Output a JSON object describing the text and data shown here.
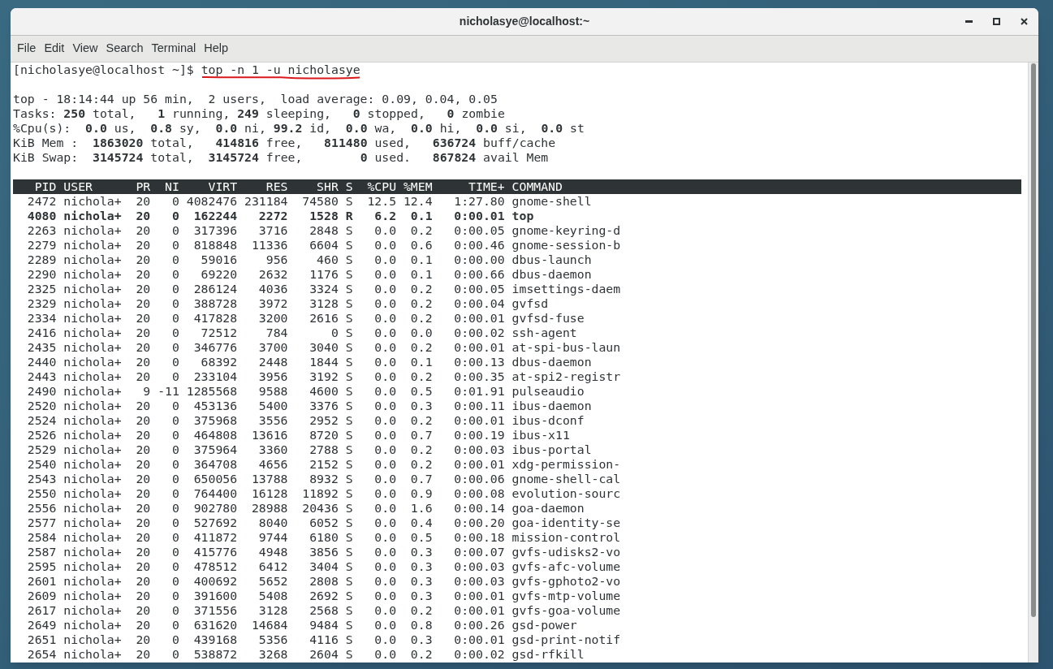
{
  "window": {
    "title": "nicholasye@localhost:~"
  },
  "menu": [
    "File",
    "Edit",
    "View",
    "Search",
    "Terminal",
    "Help"
  ],
  "prompt": {
    "text": "[nicholasye@localhost ~]$ ",
    "command": "top -n 1 -u nicholasye",
    "underlined": true
  },
  "summary": [
    "top - 18:14:44 up 56 min,  2 users,  load average: 0.09, 0.04, 0.05",
    "Tasks: **250** total,   **1** running, **249** sleeping,   **0** stopped,   **0** zombie",
    "%Cpu(s):  **0.0** us,  **0.8** sy,  **0.0** ni, **99.2** id,  **0.0** wa,  **0.0** hi,  **0.0** si,  **0.0** st",
    "KiB Mem :  **1863020** total,   **414816** free,   **811480** used,   **636724** buff/cache",
    "KiB Swap:  **3145724** total,  **3145724** free,        **0** used.   **867824** avail Mem"
  ],
  "table": {
    "columns": [
      "PID",
      "USER",
      "PR",
      "NI",
      "VIRT",
      "RES",
      "SHR",
      "S",
      "%CPU",
      "%MEM",
      "TIME+",
      "COMMAND"
    ],
    "rows": [
      {
        "highlighted": false,
        "cells": [
          "2472",
          "nichola+",
          "20",
          "0",
          "4082476",
          "231184",
          "74580",
          "S",
          "12.5",
          "12.4",
          "1:27.80",
          "gnome-shell"
        ]
      },
      {
        "highlighted": true,
        "cells": [
          "4080",
          "nichola+",
          "20",
          "0",
          "162244",
          "2272",
          "1528",
          "R",
          "6.2",
          "0.1",
          "0:00.01",
          "top"
        ]
      },
      {
        "highlighted": false,
        "cells": [
          "2263",
          "nichola+",
          "20",
          "0",
          "317396",
          "3716",
          "2848",
          "S",
          "0.0",
          "0.2",
          "0:00.05",
          "gnome-keyring-d"
        ]
      },
      {
        "highlighted": false,
        "cells": [
          "2279",
          "nichola+",
          "20",
          "0",
          "818848",
          "11336",
          "6604",
          "S",
          "0.0",
          "0.6",
          "0:00.46",
          "gnome-session-b"
        ]
      },
      {
        "highlighted": false,
        "cells": [
          "2289",
          "nichola+",
          "20",
          "0",
          "59016",
          "956",
          "460",
          "S",
          "0.0",
          "0.1",
          "0:00.00",
          "dbus-launch"
        ]
      },
      {
        "highlighted": false,
        "cells": [
          "2290",
          "nichola+",
          "20",
          "0",
          "69220",
          "2632",
          "1176",
          "S",
          "0.0",
          "0.1",
          "0:00.66",
          "dbus-daemon"
        ]
      },
      {
        "highlighted": false,
        "cells": [
          "2325",
          "nichola+",
          "20",
          "0",
          "286124",
          "4036",
          "3324",
          "S",
          "0.0",
          "0.2",
          "0:00.05",
          "imsettings-daem"
        ]
      },
      {
        "highlighted": false,
        "cells": [
          "2329",
          "nichola+",
          "20",
          "0",
          "388728",
          "3972",
          "3128",
          "S",
          "0.0",
          "0.2",
          "0:00.04",
          "gvfsd"
        ]
      },
      {
        "highlighted": false,
        "cells": [
          "2334",
          "nichola+",
          "20",
          "0",
          "417828",
          "3200",
          "2616",
          "S",
          "0.0",
          "0.2",
          "0:00.01",
          "gvfsd-fuse"
        ]
      },
      {
        "highlighted": false,
        "cells": [
          "2416",
          "nichola+",
          "20",
          "0",
          "72512",
          "784",
          "0",
          "S",
          "0.0",
          "0.0",
          "0:00.02",
          "ssh-agent"
        ]
      },
      {
        "highlighted": false,
        "cells": [
          "2435",
          "nichola+",
          "20",
          "0",
          "346776",
          "3700",
          "3040",
          "S",
          "0.0",
          "0.2",
          "0:00.01",
          "at-spi-bus-laun"
        ]
      },
      {
        "highlighted": false,
        "cells": [
          "2440",
          "nichola+",
          "20",
          "0",
          "68392",
          "2448",
          "1844",
          "S",
          "0.0",
          "0.1",
          "0:00.13",
          "dbus-daemon"
        ]
      },
      {
        "highlighted": false,
        "cells": [
          "2443",
          "nichola+",
          "20",
          "0",
          "233104",
          "3956",
          "3192",
          "S",
          "0.0",
          "0.2",
          "0:00.35",
          "at-spi2-registr"
        ]
      },
      {
        "highlighted": false,
        "cells": [
          "2490",
          "nichola+",
          "9",
          "-11",
          "1285568",
          "9588",
          "4600",
          "S",
          "0.0",
          "0.5",
          "0:01.91",
          "pulseaudio"
        ]
      },
      {
        "highlighted": false,
        "cells": [
          "2520",
          "nichola+",
          "20",
          "0",
          "453136",
          "5400",
          "3376",
          "S",
          "0.0",
          "0.3",
          "0:00.11",
          "ibus-daemon"
        ]
      },
      {
        "highlighted": false,
        "cells": [
          "2524",
          "nichola+",
          "20",
          "0",
          "375968",
          "3556",
          "2952",
          "S",
          "0.0",
          "0.2",
          "0:00.01",
          "ibus-dconf"
        ]
      },
      {
        "highlighted": false,
        "cells": [
          "2526",
          "nichola+",
          "20",
          "0",
          "464808",
          "13616",
          "8720",
          "S",
          "0.0",
          "0.7",
          "0:00.19",
          "ibus-x11"
        ]
      },
      {
        "highlighted": false,
        "cells": [
          "2529",
          "nichola+",
          "20",
          "0",
          "375964",
          "3360",
          "2788",
          "S",
          "0.0",
          "0.2",
          "0:00.03",
          "ibus-portal"
        ]
      },
      {
        "highlighted": false,
        "cells": [
          "2540",
          "nichola+",
          "20",
          "0",
          "364708",
          "4656",
          "2152",
          "S",
          "0.0",
          "0.2",
          "0:00.01",
          "xdg-permission-"
        ]
      },
      {
        "highlighted": false,
        "cells": [
          "2543",
          "nichola+",
          "20",
          "0",
          "650056",
          "13788",
          "8932",
          "S",
          "0.0",
          "0.7",
          "0:00.06",
          "gnome-shell-cal"
        ]
      },
      {
        "highlighted": false,
        "cells": [
          "2550",
          "nichola+",
          "20",
          "0",
          "764400",
          "16128",
          "11892",
          "S",
          "0.0",
          "0.9",
          "0:00.08",
          "evolution-sourc"
        ]
      },
      {
        "highlighted": false,
        "cells": [
          "2556",
          "nichola+",
          "20",
          "0",
          "902780",
          "28988",
          "20436",
          "S",
          "0.0",
          "1.6",
          "0:00.14",
          "goa-daemon"
        ]
      },
      {
        "highlighted": false,
        "cells": [
          "2577",
          "nichola+",
          "20",
          "0",
          "527692",
          "8040",
          "6052",
          "S",
          "0.0",
          "0.4",
          "0:00.20",
          "goa-identity-se"
        ]
      },
      {
        "highlighted": false,
        "cells": [
          "2584",
          "nichola+",
          "20",
          "0",
          "411872",
          "9744",
          "6180",
          "S",
          "0.0",
          "0.5",
          "0:00.18",
          "mission-control"
        ]
      },
      {
        "highlighted": false,
        "cells": [
          "2587",
          "nichola+",
          "20",
          "0",
          "415776",
          "4948",
          "3856",
          "S",
          "0.0",
          "0.3",
          "0:00.07",
          "gvfs-udisks2-vo"
        ]
      },
      {
        "highlighted": false,
        "cells": [
          "2595",
          "nichola+",
          "20",
          "0",
          "478512",
          "6412",
          "3404",
          "S",
          "0.0",
          "0.3",
          "0:00.03",
          "gvfs-afc-volume"
        ]
      },
      {
        "highlighted": false,
        "cells": [
          "2601",
          "nichola+",
          "20",
          "0",
          "400692",
          "5652",
          "2808",
          "S",
          "0.0",
          "0.3",
          "0:00.03",
          "gvfs-gphoto2-vo"
        ]
      },
      {
        "highlighted": false,
        "cells": [
          "2609",
          "nichola+",
          "20",
          "0",
          "391600",
          "5408",
          "2692",
          "S",
          "0.0",
          "0.3",
          "0:00.01",
          "gvfs-mtp-volume"
        ]
      },
      {
        "highlighted": false,
        "cells": [
          "2617",
          "nichola+",
          "20",
          "0",
          "371556",
          "3128",
          "2568",
          "S",
          "0.0",
          "0.2",
          "0:00.01",
          "gvfs-goa-volume"
        ]
      },
      {
        "highlighted": false,
        "cells": [
          "2649",
          "nichola+",
          "20",
          "0",
          "631620",
          "14684",
          "9484",
          "S",
          "0.0",
          "0.8",
          "0:00.26",
          "gsd-power"
        ]
      },
      {
        "highlighted": false,
        "cells": [
          "2651",
          "nichola+",
          "20",
          "0",
          "439168",
          "5356",
          "4116",
          "S",
          "0.0",
          "0.3",
          "0:00.01",
          "gsd-print-notif"
        ]
      },
      {
        "highlighted": false,
        "cells": [
          "2654",
          "nichola+",
          "20",
          "0",
          "538872",
          "3268",
          "2604",
          "S",
          "0.0",
          "0.2",
          "0:00.02",
          "gsd-rfkill"
        ]
      }
    ]
  }
}
